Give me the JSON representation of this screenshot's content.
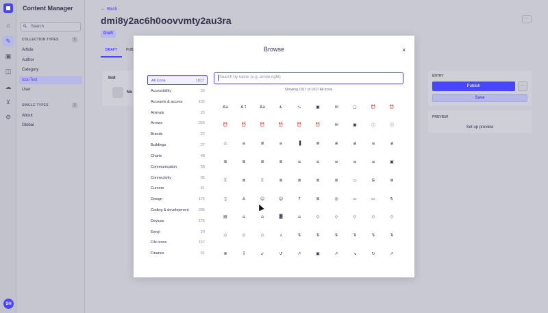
{
  "app": {
    "title": "Content Manager",
    "avatar_initials": "SH"
  },
  "rail_icons": [
    "home-icon",
    "feather-icon",
    "plugin-icon",
    "layout-icon",
    "cloud-icon",
    "cart-icon",
    "settings-icon"
  ],
  "sidebar": {
    "search_placeholder": "Search",
    "collection_title": "COLLECTION TYPES",
    "collection_count": "5",
    "collection_items": [
      "Article",
      "Author",
      "Category",
      "IconTest",
      "User"
    ],
    "single_title": "SINGLE TYPES",
    "single_count": "2",
    "single_items": [
      "About",
      "Global"
    ]
  },
  "page": {
    "back_label": "Back",
    "title": "dmi8y2ac6h0oovvmty2au3ra",
    "status": "Draft",
    "more": "···",
    "tabs": [
      "DRAFT",
      "PUB"
    ],
    "field_label": "test",
    "field_text": "No",
    "entry_heading": "ENTRY",
    "publish_label": "Publish",
    "publish_more": "···",
    "save_label": "Save",
    "preview_heading": "PREVIEW",
    "preview_setup": "Set up preview"
  },
  "modal": {
    "title": "Browse",
    "close": "×",
    "search_placeholder": "Search by name (e.g. arrow-right)",
    "showing": "Showing 1917 of 1917 All icons",
    "categories": [
      {
        "name": "All icons",
        "count": "1917"
      },
      {
        "name": "Accessibility",
        "count": "33"
      },
      {
        "name": "Accounts & access",
        "count": "163"
      },
      {
        "name": "Animals",
        "count": "23"
      },
      {
        "name": "Arrows",
        "count": "255"
      },
      {
        "name": "Brands",
        "count": "22"
      },
      {
        "name": "Buildings",
        "count": "27"
      },
      {
        "name": "Charts",
        "count": "48"
      },
      {
        "name": "Communication",
        "count": "58"
      },
      {
        "name": "Connectivity",
        "count": "85"
      },
      {
        "name": "Cursors",
        "count": "41"
      },
      {
        "name": "Design",
        "count": "176"
      },
      {
        "name": "Coding & development",
        "count": "285"
      },
      {
        "name": "Devices",
        "count": "175"
      },
      {
        "name": "Emoji",
        "count": "29"
      },
      {
        "name": "File icons",
        "count": "157"
      },
      {
        "name": "Finance",
        "count": "61"
      }
    ],
    "icon_rows": [
      [
        "Aa",
        "A↑",
        "Aa",
        "♿",
        "∿",
        "▣",
        "✉",
        "▢",
        "⏰",
        "⏰"
      ],
      [
        "⏰",
        "⏰",
        "⏰",
        "⏰",
        "⏰",
        "⏰",
        "✉",
        "▣",
        "ⓘ",
        "ⓘ"
      ],
      [
        "⚠",
        "≡",
        "≣",
        "≡",
        "▐",
        "≣",
        "≢",
        "≢",
        "≡",
        "≢"
      ],
      [
        "≣",
        "≣",
        "≣",
        "≣",
        "≡",
        "≡",
        "≡",
        "≡",
        "≡",
        "▣"
      ],
      [
        "♖",
        "≣",
        "♖",
        "≣",
        "≣",
        "≣",
        "≣",
        "▭",
        "&",
        "≣"
      ],
      [
        "▯",
        "⚓",
        "☺",
        "☺",
        "↑",
        "≣",
        "◎",
        "▭",
        "▭",
        "↻"
      ],
      [
        "▤",
        "⌂",
        "⌂",
        "▓",
        "⌂",
        "◇",
        "◇",
        "◇",
        "◇",
        "◇"
      ],
      [
        "◇",
        "◇",
        "◇",
        "↓",
        "⇅",
        "⇅",
        "⇅",
        "⇅",
        "⇅",
        "⇅"
      ],
      [
        "⊕",
        "↧",
        "↙",
        "↺",
        "↗",
        "▣",
        "↗",
        "↘",
        "↻",
        "↗"
      ]
    ]
  }
}
